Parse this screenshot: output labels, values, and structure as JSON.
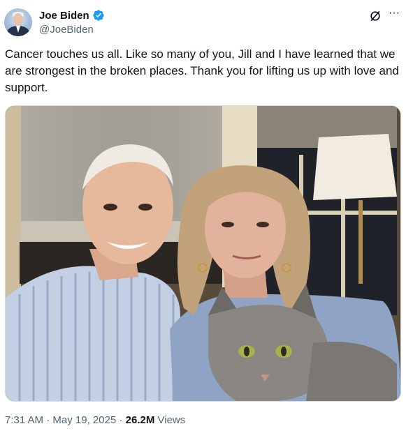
{
  "author": {
    "name": "Joe Biden",
    "handle": "@JoeBiden",
    "verified_color": "#1d9bf0"
  },
  "tweet": {
    "text": "Cancer touches us all. Like so many of you, Jill and I have learned that we are strongest in the broken places. Thank you for lifting us up with love and support."
  },
  "media": {
    "icon": "photo-image"
  },
  "meta": {
    "time": "7:31 AM",
    "separator": "·",
    "date": "May 19, 2025",
    "views_count": "26.2M",
    "views_label": "Views"
  },
  "actions": {
    "grok_icon": "grok-icon",
    "more_icon": "more-icon"
  },
  "colors": {
    "text": "#0f1419",
    "secondary": "#536471",
    "accent": "#1d9bf0"
  }
}
